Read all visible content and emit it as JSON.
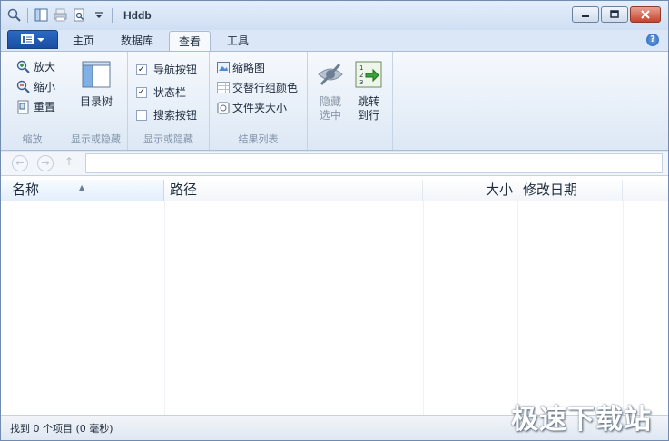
{
  "window": {
    "title": "Hddb"
  },
  "tabs": [
    {
      "label": "主页"
    },
    {
      "label": "数据库"
    },
    {
      "label": "查看"
    },
    {
      "label": "工具"
    }
  ],
  "ribbon": {
    "zoom": {
      "zoom_in": "放大",
      "zoom_out": "缩小",
      "reset": "重置",
      "group_label": "缩放"
    },
    "tree": {
      "label": "目录树",
      "group_label": "显示或隐藏"
    },
    "panes": {
      "nav_buttons": "导航按钮",
      "status_bar": "状态栏",
      "search_button": "搜索按钮",
      "group_label": "显示或隐藏"
    },
    "results": {
      "thumbnails": "缩略图",
      "alternate_color": "交替行组颜色",
      "folder_size": "文件夹大小",
      "group_label": "结果列表"
    },
    "hide_selected": {
      "line1": "隐藏",
      "line2": "选中"
    },
    "goto_row": {
      "line1": "跳转",
      "line2": "到行"
    }
  },
  "address": {
    "value": ""
  },
  "columns": [
    {
      "label": "名称"
    },
    {
      "label": "路径"
    },
    {
      "label": "大小"
    },
    {
      "label": "修改日期"
    }
  ],
  "status": {
    "text": "找到 0 个项目 (0 毫秒)"
  },
  "watermark": "极速下载站",
  "colors": {
    "accent": "#1b4ea1",
    "ribbon_bg": "#eef3fa",
    "close_button": "#c7432e"
  }
}
